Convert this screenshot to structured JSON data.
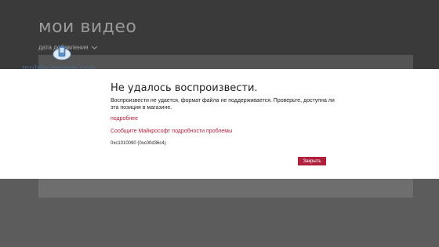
{
  "app": {
    "title": "мои видео",
    "sort_label": "дата добавления"
  },
  "watermark": {
    "text": "mobile-review.com"
  },
  "dialog": {
    "title": "Не удалось воспроизвести.",
    "message": "Воспроизвести не удается, формат файла не поддерживается. Проверьте, доступна ли эта позиция в магазине.",
    "more_link": "подробнее",
    "report_link": "Сообщите Майкрософт подробности проблемы",
    "error_code": "0xc1010090 (0xc00d36c4)",
    "close_label": "Закрыть"
  },
  "colors": {
    "accent": "#b0203c",
    "background_dark": "#3a3a3a",
    "background_mid": "#5a5a5a"
  }
}
